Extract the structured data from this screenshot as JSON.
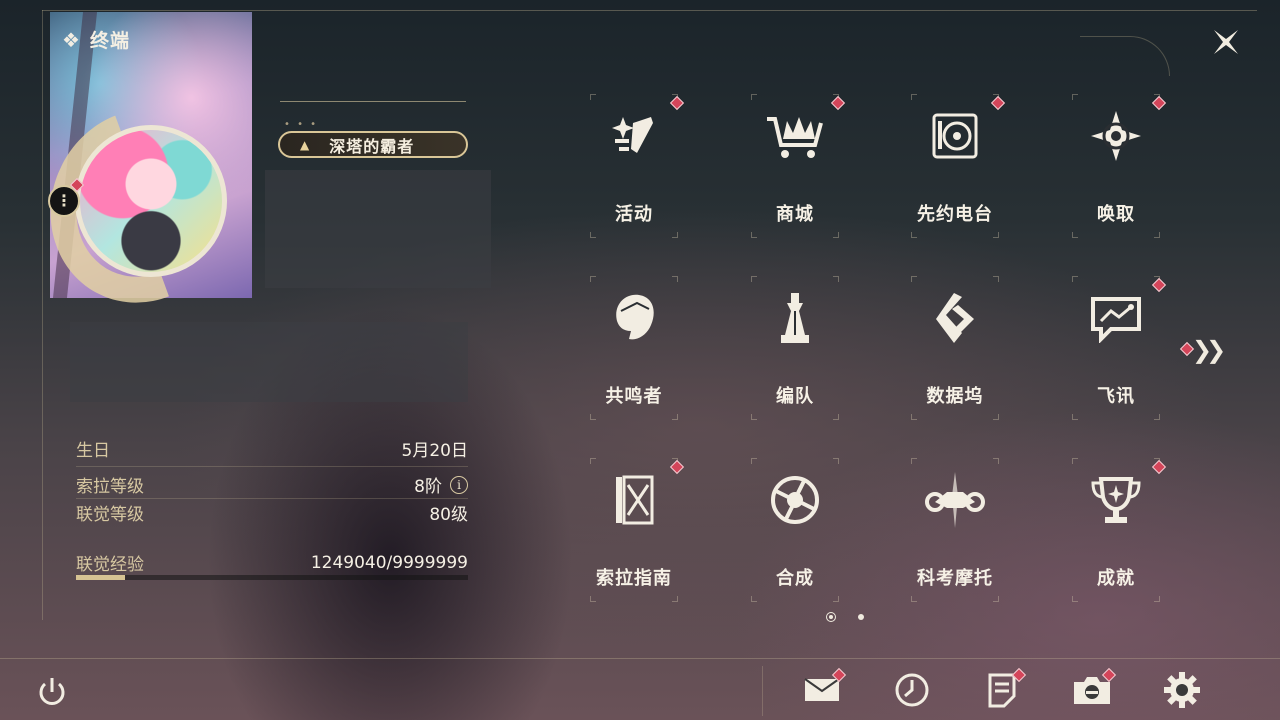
{
  "header": {
    "title": "终端",
    "title_icon": "diamond-cluster-icon",
    "close_icon": "close-icon"
  },
  "profile": {
    "title_badge": "深塔的霸者",
    "avatar_menu_icon": "more-vertical-icon"
  },
  "stats": {
    "birthday": {
      "label": "生日",
      "value": "5月20日"
    },
    "sola_level": {
      "label": "索拉等级",
      "value": "8阶",
      "info_icon": "i"
    },
    "union_level": {
      "label": "联觉等级",
      "value": "80级"
    },
    "union_exp": {
      "label": "联觉经验",
      "value": "1249040/9999999",
      "fill_fraction": 0.125
    }
  },
  "menu": [
    {
      "label": "活动",
      "icon": "activity-sparkle-icon",
      "badge": true
    },
    {
      "label": "商城",
      "icon": "shop-cart-icon",
      "badge": true
    },
    {
      "label": "先约电台",
      "icon": "radio-record-icon",
      "badge": true
    },
    {
      "label": "唤取",
      "icon": "convene-compass-icon",
      "badge": true
    },
    {
      "label": "共鸣者",
      "icon": "resonator-portrait-icon",
      "badge": false
    },
    {
      "label": "编队",
      "icon": "team-chess-icon",
      "badge": false
    },
    {
      "label": "数据坞",
      "icon": "data-bank-icon",
      "badge": false
    },
    {
      "label": "飞讯",
      "icon": "message-chat-icon",
      "badge": true
    },
    {
      "label": "索拉指南",
      "icon": "guidebook-icon",
      "badge": true
    },
    {
      "label": "合成",
      "icon": "synthesis-orb-icon",
      "badge": false
    },
    {
      "label": "科考摩托",
      "icon": "motorbike-icon",
      "badge": false
    },
    {
      "label": "成就",
      "icon": "trophy-icon",
      "badge": true
    }
  ],
  "pager": {
    "pages": 2,
    "current": 1,
    "next_icon": "double-chevron-right-icon"
  },
  "bottom_bar": {
    "power_icon": "power-icon",
    "buttons": [
      {
        "icon": "mail-icon",
        "badge": true
      },
      {
        "icon": "clock-icon",
        "badge": false
      },
      {
        "icon": "notice-document-icon",
        "badge": true
      },
      {
        "icon": "camera-icon",
        "badge": true
      },
      {
        "icon": "settings-gear-icon",
        "badge": false
      }
    ]
  },
  "colors": {
    "accent_gold": "#d9c697",
    "badge_red": "#d4455a",
    "text_light": "#f6f1e6"
  }
}
